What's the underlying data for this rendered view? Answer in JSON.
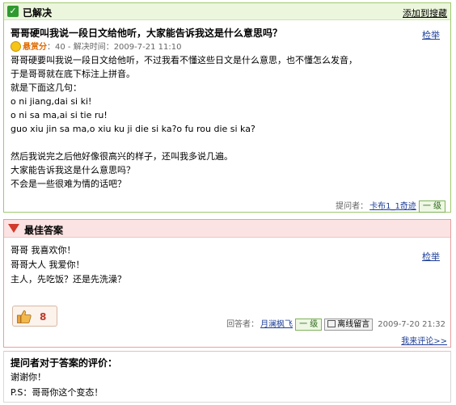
{
  "question": {
    "status": "已解决",
    "add_search_link": "添加到搜藏",
    "title": "哥哥硬叫我说一段日文给他听，大家能告诉我这是什么意思吗？",
    "report": "检举",
    "bounty_label": "悬赏分",
    "bounty_value": "：40 - 解决时间：2009-7-21 11:10",
    "body_lines": [
      "哥哥硬要叫我说一段日文给他听，不过我看不懂这些日文是什么意思，也不懂怎么发音，",
      "于是哥哥就在底下标注上拼音。",
      "就是下面这几句：",
      "o ni jiang,dai si ki!",
      "o ni sa ma,ai si tie ru!",
      "guo xiu jin sa ma,o xiu ku ji die si ka?o fu rou die si ka?",
      "",
      "然后我说完之后他好像很高兴的样子，还叫我多说几遍。",
      "大家能告诉我这是什么意思吗？",
      "不会是一些很难为情的话吧？"
    ],
    "asker_label": "提问者：",
    "asker_name": "卡布1_1奇迹",
    "asker_level": "一 级"
  },
  "answer": {
    "heading": "最佳答案",
    "report": "检举",
    "body_lines": [
      "哥哥  我喜欢你！",
      "哥哥大人  我爱你！",
      "主人，先吃饭？还是先洗澡？"
    ],
    "like_count": "8",
    "answerer_label": "回答者：",
    "answerer_name": "月澜枫飞",
    "answerer_level": "一 级",
    "message_button": "离线留言",
    "answer_date": "2009-7-20 21:32",
    "comment_link": "我来评论>>"
  },
  "evaluation": {
    "title": "提问者对于答案的评价：",
    "lines": [
      "谢谢你！",
      "P.S：哥哥你这个变态！"
    ]
  }
}
